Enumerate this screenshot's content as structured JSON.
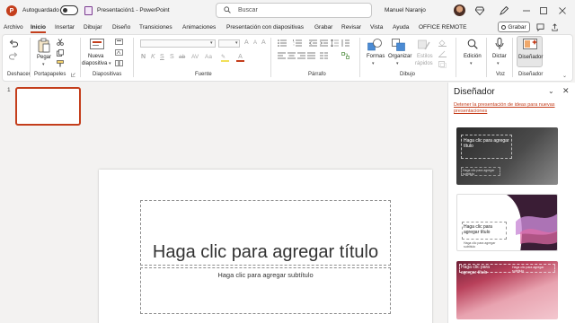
{
  "titlebar": {
    "app_logo_letter": "P",
    "autosave_label": "Autoguardado",
    "doc_title": "Presentación1  -  PowerPoint",
    "search_placeholder": "Buscar",
    "user_name": "Manuel Naranjo",
    "icons": [
      "search-icon",
      "diamond-icon",
      "pen-icon",
      "minimize-icon",
      "maximize-icon",
      "close-icon"
    ]
  },
  "tabs": [
    "Archivo",
    "Inicio",
    "Insertar",
    "Dibujar",
    "Diseño",
    "Transiciones",
    "Animaciones",
    "Presentación con diapositivas",
    "Grabar",
    "Revisar",
    "Vista",
    "Ayuda",
    "OFFICE REMOTE"
  ],
  "active_tab": "Inicio",
  "grabar_label": "Grabar",
  "ribbon": {
    "groups": {
      "deshacer": "Deshacer",
      "portapapeles": "Portapapeles",
      "diapositivas": "Diapositivas",
      "fuente": "Fuente",
      "parrafo": "Párrafo",
      "dibujo": "Dibujo",
      "voz": "Voz",
      "disenador": "Diseñador"
    },
    "buttons": {
      "pegar": "Pegar",
      "nueva": "Nueva",
      "diapositiva": "diapositiva",
      "formas": "Formas",
      "organizar": "Organizar",
      "estilos": "Estilos",
      "rapidos": "rápidos",
      "edicion": "Edición",
      "dictar": "Dictar",
      "disenador": "Diseñador"
    },
    "font_formatting": [
      "N",
      "K",
      "S",
      "S",
      "ab",
      "AV",
      "Aa"
    ]
  },
  "thumbnails": [
    {
      "number": "1"
    }
  ],
  "slide": {
    "title_placeholder": "Haga clic para agregar título",
    "subtitle_placeholder": "Haga clic para agregar subtítulo"
  },
  "designer": {
    "title": "Diseñador",
    "link": "Detener la presentación de ideas para nuevas presentaciones",
    "cards": [
      {
        "title": "Haga clic para agregar título",
        "subtitle": "Haga clic para agregar subtítulo"
      },
      {
        "title": "Haga clic para agregar título",
        "subtitle": "Haga clic para agregar subtítulo"
      },
      {
        "title": "Haga clic para agregar título",
        "subtitle": "Haga clic para agregar subtítulo"
      }
    ]
  },
  "colors": {
    "accent": "#c43e1c",
    "ribbon_bg": "#ffffff",
    "chrome_bg": "#f3f3f3"
  }
}
